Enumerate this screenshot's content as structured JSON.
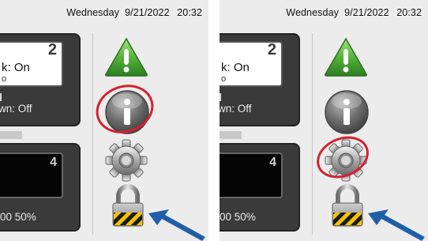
{
  "panels": [
    {
      "datetime": {
        "day": "Wednesday",
        "date": "9/21/2022",
        "time": "20:32"
      },
      "zone_top": {
        "number": "2",
        "status": "k: On",
        "sub": "o",
        "shutdown": "wn: Off"
      },
      "zone_bottom": {
        "number": "4",
        "footer": "00  50%"
      },
      "icons": {
        "warning": "warning-triangle-icon",
        "info": "info-icon",
        "settings": "gear-icon",
        "lock": "padlock-icon"
      },
      "highlighted": "info-icon"
    },
    {
      "datetime": {
        "day": "Wednesday",
        "date": "9/21/2022",
        "time": "20:32"
      },
      "zone_top": {
        "number": "2",
        "status": "k: On",
        "sub": "o",
        "shutdown": "wn: Off"
      },
      "zone_bottom": {
        "number": "4",
        "footer": "00  50%"
      },
      "icons": {
        "warning": "warning-triangle-icon",
        "info": "info-icon",
        "settings": "gear-icon",
        "lock": "padlock-icon"
      },
      "highlighted": "gear-icon"
    }
  ],
  "colors": {
    "highlight": "#d4212f",
    "arrow": "#1f5fa8",
    "warning_green": "#3f9a2f",
    "screen_dark": "#3a3a3a"
  }
}
